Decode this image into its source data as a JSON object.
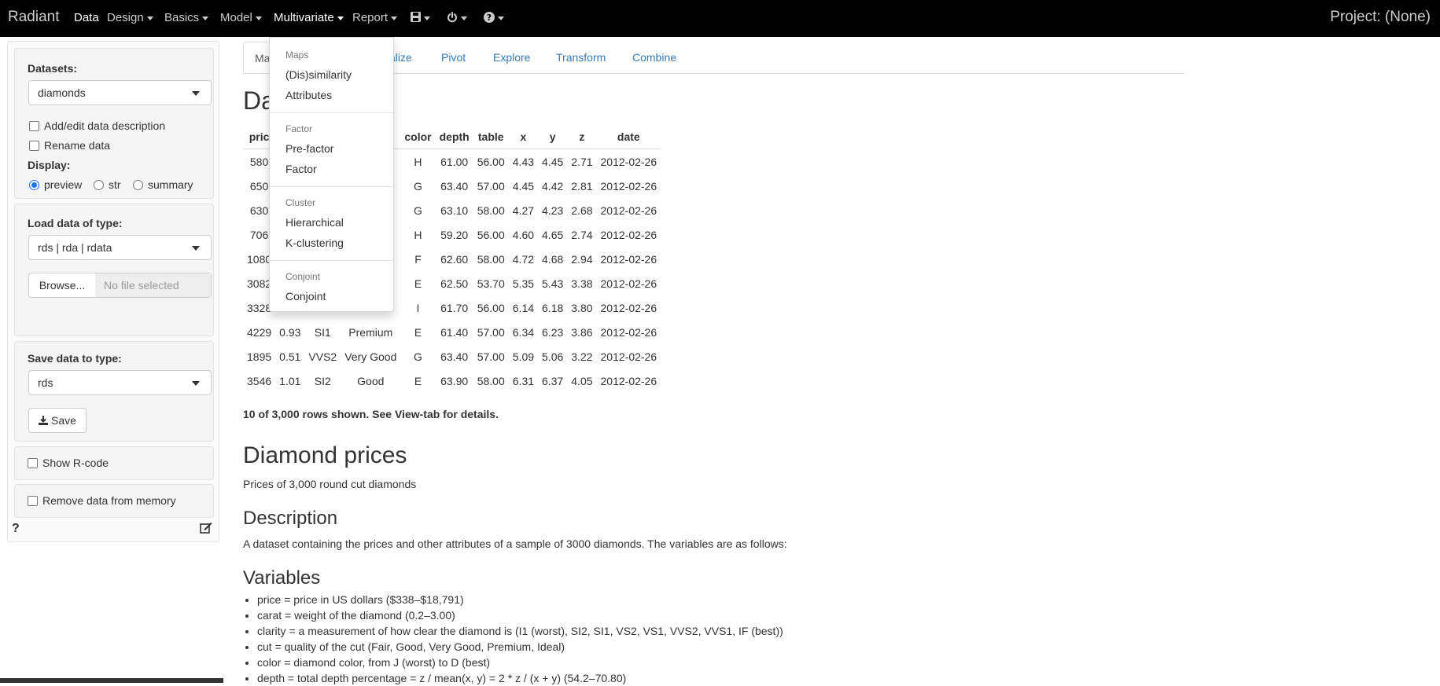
{
  "app": {
    "brand": "Radiant",
    "project": "Project: (None)"
  },
  "nav": {
    "items": [
      {
        "label": "Data",
        "caret": false
      },
      {
        "label": "Design",
        "caret": true
      },
      {
        "label": "Basics",
        "caret": true
      },
      {
        "label": "Model",
        "caret": true
      },
      {
        "label": "Multivariate",
        "caret": true
      },
      {
        "label": "Report",
        "caret": true
      }
    ],
    "icons": [
      "save-icon",
      "power-icon",
      "question-icon"
    ]
  },
  "menu": {
    "sections": [
      {
        "header": "Maps",
        "items": [
          "(Dis)similarity",
          "Attributes"
        ]
      },
      {
        "header": "Factor",
        "items": [
          "Pre-factor",
          "Factor"
        ]
      },
      {
        "header": "Cluster",
        "items": [
          "Hierarchical",
          "K-clustering"
        ]
      },
      {
        "header": "Conjoint",
        "items": [
          "Conjoint"
        ]
      }
    ]
  },
  "sidebar": {
    "datasets_label": "Datasets:",
    "dataset_value": "diamonds",
    "add_desc": "Add/edit data description",
    "rename": "Rename data",
    "display_label": "Display:",
    "display_options": [
      "preview",
      "str",
      "summary"
    ],
    "display_selected": "preview",
    "load_label": "Load data of type:",
    "load_value": "rds | rda | rdata",
    "browse": "Browse...",
    "no_file": "No file selected",
    "save_label": "Save data to type:",
    "save_value": "rds",
    "save_button": "Save",
    "show_rcode": "Show R-code",
    "remove": "Remove data from memory",
    "help": "?"
  },
  "tabs": [
    {
      "label": "Ma",
      "active": true
    },
    {
      "label": "alize",
      "active": false
    },
    {
      "label": "Pivot",
      "active": false
    },
    {
      "label": "Explore",
      "active": false
    },
    {
      "label": "Transform",
      "active": false
    },
    {
      "label": "Combine",
      "active": false
    }
  ],
  "main": {
    "heading": "Da",
    "table": {
      "headers": [
        "pric",
        "",
        "",
        "",
        "color",
        "depth",
        "table",
        "x",
        "y",
        "z",
        "date"
      ],
      "rows": [
        [
          "580",
          "",
          "",
          "",
          "H",
          "61.00",
          "56.00",
          "4.43",
          "4.45",
          "2.71",
          "2012-02-26"
        ],
        [
          "650",
          "",
          "",
          "ood",
          "G",
          "63.40",
          "57.00",
          "4.45",
          "4.42",
          "2.81",
          "2012-02-26"
        ],
        [
          "630",
          "",
          "",
          "ood",
          "G",
          "63.10",
          "58.00",
          "4.27",
          "4.23",
          "2.68",
          "2012-02-26"
        ],
        [
          "706",
          "",
          "",
          "",
          "H",
          "59.20",
          "56.00",
          "4.60",
          "4.65",
          "2.74",
          "2012-02-26"
        ],
        [
          "1080",
          "",
          "",
          "um",
          "F",
          "62.60",
          "58.00",
          "4.72",
          "4.68",
          "2.94",
          "2012-02-26"
        ],
        [
          "3082",
          "",
          "",
          "",
          "E",
          "62.50",
          "53.70",
          "5.35",
          "5.43",
          "3.38",
          "2012-02-26"
        ],
        [
          "3328",
          "",
          "",
          "",
          "I",
          "61.70",
          "56.00",
          "6.14",
          "6.18",
          "3.80",
          "2012-02-26"
        ],
        [
          "4229",
          "0.93",
          "SI1",
          "Premium",
          "E",
          "61.40",
          "57.00",
          "6.34",
          "6.23",
          "3.86",
          "2012-02-26"
        ],
        [
          "1895",
          "0.51",
          "VVS2",
          "Very Good",
          "G",
          "63.40",
          "57.00",
          "5.09",
          "5.06",
          "3.22",
          "2012-02-26"
        ],
        [
          "3546",
          "1.01",
          "SI2",
          "Good",
          "E",
          "63.90",
          "58.00",
          "6.31",
          "6.37",
          "4.05",
          "2012-02-26"
        ]
      ]
    },
    "rows_note": "10 of 3,000 rows shown. See View-tab for details.",
    "title": "Diamond prices",
    "subtitle": "Prices of 3,000 round cut diamonds",
    "desc_heading": "Description",
    "desc_text": "A dataset containing the prices and other attributes of a sample of 3000 diamonds. The variables are as follows:",
    "vars_heading": "Variables",
    "variables": [
      "price = price in US dollars ($338–$18,791)",
      "carat = weight of the diamond (0.2–3.00)",
      "clarity = a measurement of how clear the diamond is (I1 (worst), SI2, SI1, VS2, VS1, VVS2, VVS1, IF (best))",
      "cut = quality of the cut (Fair, Good, Very Good, Premium, Ideal)",
      "color = diamond color, from J (worst) to D (best)",
      "depth = total depth percentage = z / mean(x, y) = 2 * z / (x + y) (54.2–70.80)"
    ]
  }
}
